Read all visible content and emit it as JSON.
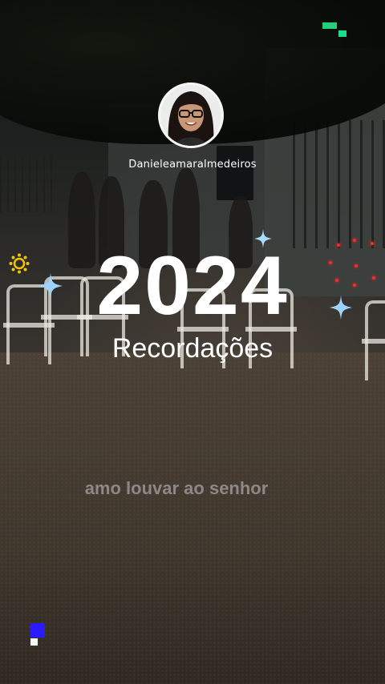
{
  "profile": {
    "username": "Danieleamaralmedeiros",
    "avatar": "avatar-photo"
  },
  "headline": {
    "year": "2024",
    "subtitle": "Recordações"
  },
  "caption": "amo louvar ao senhor",
  "icons": [
    "sparkle-icon",
    "sun-icon",
    "green-pixel-icon",
    "blue-pixel-icon"
  ],
  "colors": {
    "text": "#ffffff",
    "sparkle": "#9fd3ff",
    "sun": "#f2c500",
    "pixel_green": "#22d07a",
    "pixel_blue": "#2b1bff"
  }
}
